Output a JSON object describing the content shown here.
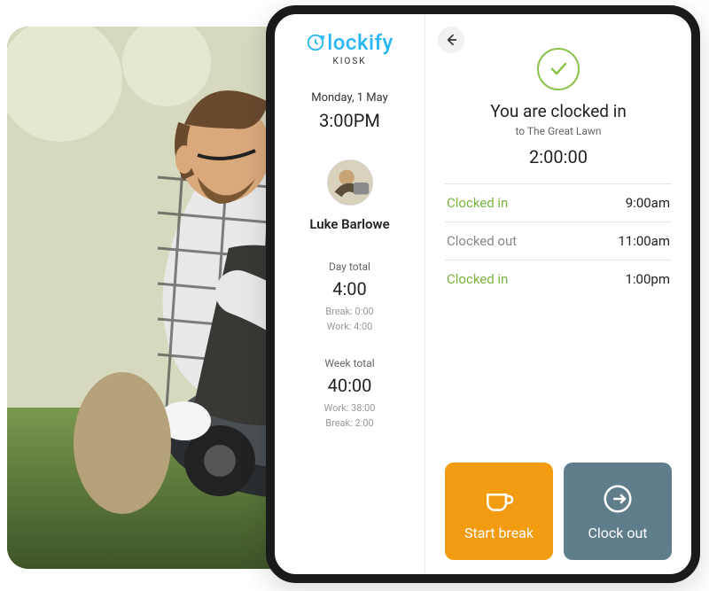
{
  "sidebar": {
    "brand": "lockify",
    "brand_c": "C",
    "subtitle": "KIOSK",
    "date": "Monday, 1 May",
    "time": "3:00PM",
    "user": "Luke Barlowe",
    "day": {
      "label": "Day total",
      "value": "4:00",
      "break": "Break: 0:00",
      "work": "Work: 4:00"
    },
    "week": {
      "label": "Week total",
      "value": "40:00",
      "work": "Work: 38:00",
      "break": "Break: 2:00"
    }
  },
  "main": {
    "status_title": "You are clocked in",
    "status_to": "to The Great Lawn",
    "elapsed": "2:00:00",
    "log": [
      {
        "label": "Clocked in",
        "kind": "in",
        "time": "9:00am"
      },
      {
        "label": "Clocked out",
        "kind": "out",
        "time": "11:00am"
      },
      {
        "label": "Clocked in",
        "kind": "in",
        "time": "1:00pm"
      }
    ],
    "actions": {
      "start_break": "Start break",
      "clock_out": "Clock out"
    }
  }
}
